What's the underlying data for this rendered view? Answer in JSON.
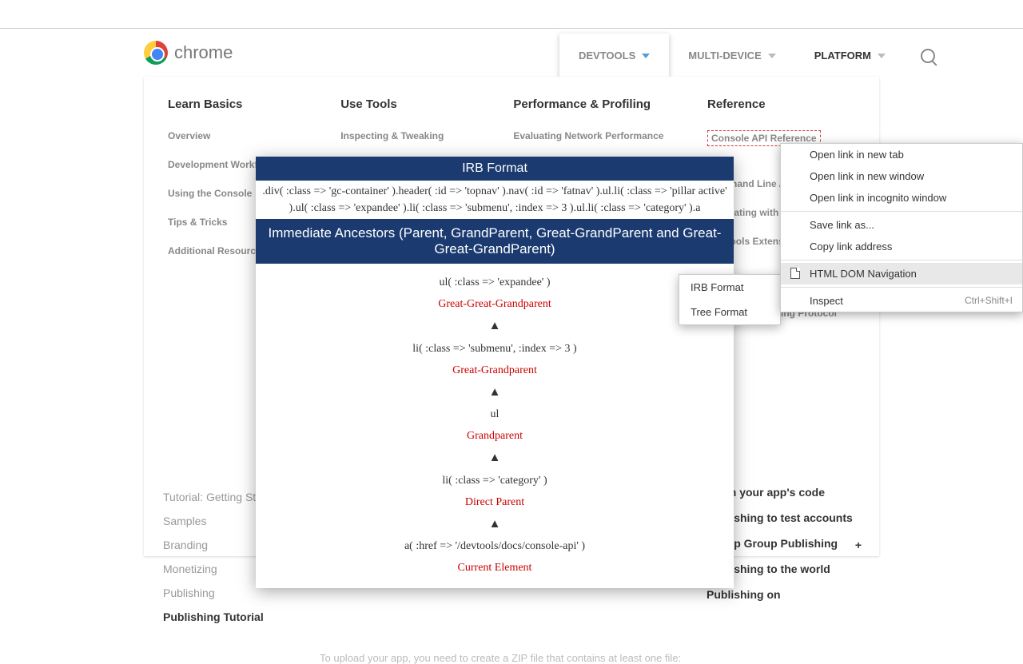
{
  "logo_text": "chrome",
  "nav": {
    "devtools": "DEVTOOLS",
    "multi": "MULTI-DEVICE",
    "platform": "PLATFORM"
  },
  "cols": {
    "a": {
      "h": "Learn Basics",
      "items": [
        "Overview",
        "Development Workflow",
        "Using the Console",
        "Tips & Tricks",
        "Additional Resources"
      ]
    },
    "b": {
      "h": "Use Tools",
      "items": [
        "Inspecting & Tweaking"
      ]
    },
    "c": {
      "h": "Performance & Profiling",
      "items": [
        "Evaluating Network Performance"
      ]
    },
    "d": {
      "h": "Reference",
      "items": [
        "Console API Reference",
        "Command Line API",
        "Integrating with DevTools",
        "DevTools Extensions API",
        "Remote Debugging Protocol"
      ]
    }
  },
  "left": [
    "Tutorial: Getting Started",
    "Samples",
    "Branding",
    "Monetizing",
    "Publishing",
    "Publishing Tutorial"
  ],
  "right": [
    "finish your app's code",
    "Publishing to test accounts",
    "Set up Group Publishing",
    "Publishing to the world",
    "Publishing on"
  ],
  "footnote": "To upload your app, you need to create a ZIP file that contains at least one file:",
  "popup": {
    "h1": "IRB Format",
    "code": ".div( :class => 'gc-container' ).header( :id => 'topnav' ).nav( :id => 'fatnav' ).ul.li( :class => 'pillar active' ).ul( :class => 'expandee' ).li( :class => 'submenu', :index => 3 ).ul.li( :class => 'category' ).a",
    "h2": "Immediate Ancestors (Parent, GrandParent, Great-GrandParent and Great-Great-GrandParent)",
    "tree": [
      {
        "c": "ul( :class => 'expandee' )",
        "l": "Great-Great-Grandparent"
      },
      {
        "c": "li( :class => 'submenu', :index => 3 )",
        "l": "Great-Grandparent"
      },
      {
        "c": "ul",
        "l": "Grandparent"
      },
      {
        "c": "li( :class => 'category' )",
        "l": "Direct Parent"
      },
      {
        "c": "a( :href => '/devtools/docs/console-api' )",
        "l": "Current Element"
      }
    ]
  },
  "ctx": [
    "Open link in new tab",
    "Open link in new window",
    "Open link in incognito window",
    "Save link as...",
    "Copy link address",
    "HTML DOM Navigation",
    "Inspect"
  ],
  "ctx_shortcut": "Ctrl+Shift+I",
  "sub": [
    "IRB Format",
    "Tree Format"
  ]
}
